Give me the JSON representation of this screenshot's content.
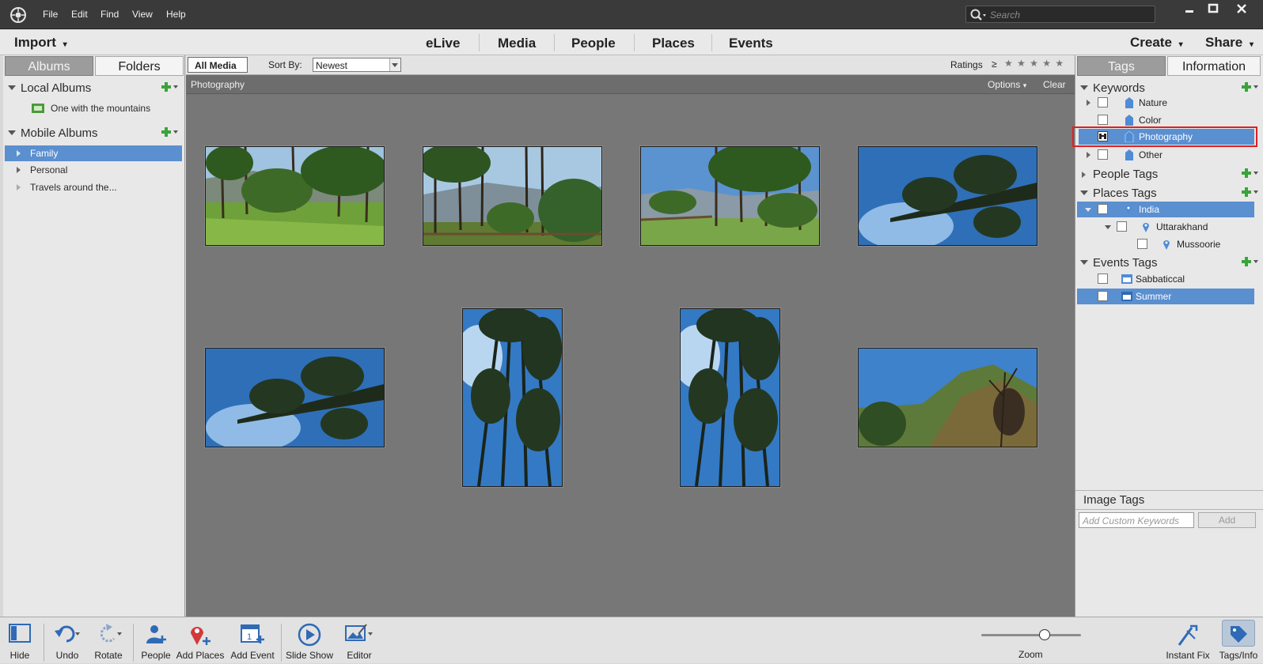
{
  "menu": {
    "items": [
      "File",
      "Edit",
      "Find",
      "View",
      "Help"
    ]
  },
  "search": {
    "placeholder": "Search"
  },
  "nav": {
    "import": "Import",
    "tabs": [
      "eLive",
      "Media",
      "People",
      "Places",
      "Events"
    ],
    "create": "Create",
    "share": "Share"
  },
  "left": {
    "tabs": [
      "Albums",
      "Folders"
    ],
    "local_albums": {
      "title": "Local Albums",
      "items": [
        "One with the mountains"
      ]
    },
    "mobile_albums": {
      "title": "Mobile Albums",
      "items": [
        "Family",
        "Personal",
        "Travels around the..."
      ]
    }
  },
  "filter": {
    "all_media": "All Media",
    "sort_by_label": "Sort By:",
    "sort_value": "Newest",
    "ratings_label": "Ratings",
    "ratings_op": "≥",
    "stars": "★ ★ ★ ★ ★"
  },
  "crumb": {
    "tag": "Photography",
    "options": "Options",
    "clear": "Clear"
  },
  "right": {
    "tabs": [
      "Tags",
      "Information"
    ],
    "keywords": {
      "title": "Keywords",
      "items": [
        "Nature",
        "Color",
        "Photography",
        "Other"
      ]
    },
    "people_tags": {
      "title": "People Tags"
    },
    "places_tags": {
      "title": "Places Tags",
      "items": [
        "India",
        "Uttarakhand",
        "Mussoorie"
      ]
    },
    "events_tags": {
      "title": "Events Tags",
      "items": [
        "Sabbaticcal",
        "Summer"
      ]
    },
    "image_tags": {
      "title": "Image Tags",
      "placeholder": "Add Custom Keywords",
      "add": "Add"
    }
  },
  "toolbar": {
    "hide": "Hide",
    "undo": "Undo",
    "rotate": "Rotate",
    "people": "People",
    "add_places": "Add Places",
    "add_event": "Add Event",
    "slide_show": "Slide Show",
    "editor": "Editor",
    "zoom": "Zoom",
    "instant_fix": "Instant Fix",
    "tags_info": "Tags/Info",
    "zoom_level": 0.65
  },
  "colors": {
    "accent": "#5a8fd0",
    "highlight_box": "#e02020",
    "add_green": "#3aa43a"
  },
  "photos": [
    {
      "type": "forest-grass"
    },
    {
      "type": "forest-valley"
    },
    {
      "type": "forest-fence"
    },
    {
      "type": "sky-tree-down"
    },
    {
      "type": "sky-tree-down"
    },
    {
      "type": "sky-trees-up"
    },
    {
      "type": "sky-trees-up"
    },
    {
      "type": "mountain"
    }
  ]
}
